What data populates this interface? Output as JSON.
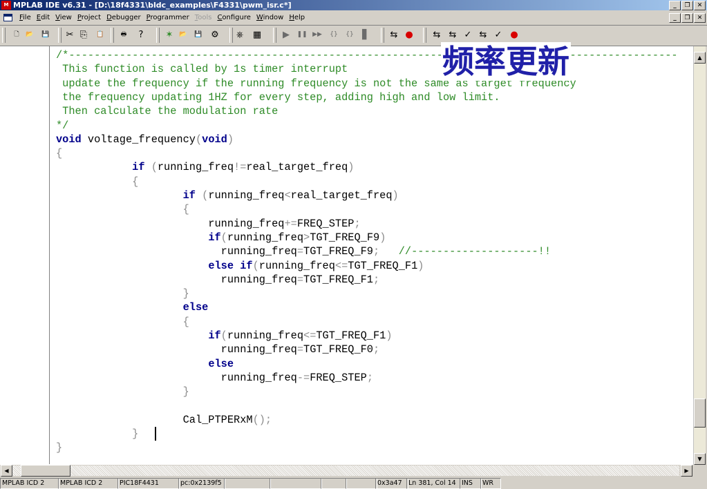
{
  "window": {
    "title": "MPLAB IDE v6.31 - [D:\\18f4331\\bldc_examples\\F4331\\pwm_isr.c*]",
    "app_icon_text": "M",
    "controls": {
      "minimize": "_",
      "restore": "❐",
      "close": "✕"
    }
  },
  "menu": {
    "items": [
      {
        "label": "File",
        "enabled": true
      },
      {
        "label": "Edit",
        "enabled": true
      },
      {
        "label": "View",
        "enabled": true
      },
      {
        "label": "Project",
        "enabled": true
      },
      {
        "label": "Debugger",
        "enabled": true
      },
      {
        "label": "Programmer",
        "enabled": true
      },
      {
        "label": "Tools",
        "enabled": false
      },
      {
        "label": "Configure",
        "enabled": true
      },
      {
        "label": "Window",
        "enabled": true
      },
      {
        "label": "Help",
        "enabled": true
      }
    ]
  },
  "toolbar": {
    "buttons": [
      {
        "name": "new-file-icon",
        "glyph": "🗋",
        "color": "#000000"
      },
      {
        "name": "open-file-icon",
        "glyph": "📂",
        "color": "#c09000"
      },
      {
        "name": "save-icon",
        "glyph": "💾",
        "color": "#000000"
      },
      {
        "name": "cut-icon",
        "glyph": "✂",
        "color": "#000000"
      },
      {
        "name": "copy-icon",
        "glyph": "⎘",
        "color": "#000000"
      },
      {
        "name": "paste-icon",
        "glyph": "📋",
        "color": "#000000"
      },
      {
        "name": "print-icon",
        "glyph": "🖶",
        "color": "#000000"
      },
      {
        "name": "help-icon",
        "glyph": "?",
        "color": "#000000"
      },
      {
        "name": "new-project-icon",
        "glyph": "✶",
        "color": "#2e8b27"
      },
      {
        "name": "open-project-icon",
        "glyph": "📂",
        "color": "#c09000"
      },
      {
        "name": "save-project-icon",
        "glyph": "💾",
        "color": "#000000"
      },
      {
        "name": "project-wizard-icon",
        "glyph": "⚙",
        "color": "#000000"
      },
      {
        "name": "build-icon",
        "glyph": "⎈",
        "color": "#000000"
      },
      {
        "name": "build-all-icon",
        "glyph": "▦",
        "color": "#000000"
      },
      {
        "name": "run-icon",
        "glyph": "▶",
        "color": "#6b6b6b"
      },
      {
        "name": "halt-icon",
        "glyph": "❚❚",
        "color": "#6b6b6b"
      },
      {
        "name": "animate-icon",
        "glyph": "▶▶",
        "color": "#6b6b6b"
      },
      {
        "name": "step-into-icon",
        "glyph": "{}",
        "color": "#6b6b6b"
      },
      {
        "name": "step-over-icon",
        "glyph": "{}",
        "color": "#6b6b6b"
      },
      {
        "name": "reset-icon",
        "glyph": "▋",
        "color": "#6b6b6b"
      },
      {
        "name": "debugger-connect-icon",
        "glyph": "⇆",
        "color": "#000000"
      },
      {
        "name": "debugger-settings-icon",
        "glyph": "●",
        "color": "#d80000"
      },
      {
        "name": "program-icon",
        "glyph": "⇆",
        "color": "#000000"
      },
      {
        "name": "read-icon",
        "glyph": "⇆",
        "color": "#000000"
      },
      {
        "name": "verify-icon",
        "glyph": "✓",
        "color": "#000000"
      },
      {
        "name": "erase-icon",
        "glyph": "⇆",
        "color": "#000000"
      },
      {
        "name": "blank-check-icon",
        "glyph": "✓",
        "color": "#000000"
      },
      {
        "name": "programmer-settings-icon",
        "glyph": "●",
        "color": "#d80000"
      }
    ]
  },
  "editor": {
    "overlay_text": "频率更新",
    "lines": [
      [
        {
          "t": "/*------------------------------------------------------------------------------------------------",
          "c": "cm"
        }
      ],
      [
        {
          "t": " This function is called by 1s timer interrupt",
          "c": "cm"
        }
      ],
      [
        {
          "t": " update the frequency if the running frequency is not the same as target frequency",
          "c": "cm"
        }
      ],
      [
        {
          "t": " the frequency updating 1HZ for every step, adding high and low limit.",
          "c": "cm"
        }
      ],
      [
        {
          "t": " Then calculate the modulation rate",
          "c": "cm"
        }
      ],
      [
        {
          "t": "*/",
          "c": "cm"
        }
      ],
      [
        {
          "t": "void",
          "c": "kw"
        },
        {
          "t": " voltage_frequency",
          "c": "pl"
        },
        {
          "t": "(",
          "c": "pu"
        },
        {
          "t": "void",
          "c": "kw"
        },
        {
          "t": ")",
          "c": "pu"
        }
      ],
      [
        {
          "t": "{",
          "c": "pu"
        }
      ],
      [
        {
          "t": "            ",
          "c": "pl"
        },
        {
          "t": "if",
          "c": "kw"
        },
        {
          "t": " (",
          "c": "pu"
        },
        {
          "t": "running_freq",
          "c": "pl"
        },
        {
          "t": "!=",
          "c": "pu"
        },
        {
          "t": "real_target_freq",
          "c": "pl"
        },
        {
          "t": ")",
          "c": "pu"
        }
      ],
      [
        {
          "t": "            {",
          "c": "pu"
        }
      ],
      [
        {
          "t": "                    ",
          "c": "pl"
        },
        {
          "t": "if",
          "c": "kw"
        },
        {
          "t": " (",
          "c": "pu"
        },
        {
          "t": "running_freq",
          "c": "pl"
        },
        {
          "t": "<",
          "c": "pu"
        },
        {
          "t": "real_target_freq",
          "c": "pl"
        },
        {
          "t": ")",
          "c": "pu"
        }
      ],
      [
        {
          "t": "                    {",
          "c": "pu"
        }
      ],
      [
        {
          "t": "                        running_freq",
          "c": "pl"
        },
        {
          "t": "+=",
          "c": "pu"
        },
        {
          "t": "FREQ_STEP",
          "c": "pl"
        },
        {
          "t": ";",
          "c": "pu"
        }
      ],
      [
        {
          "t": "                        ",
          "c": "pl"
        },
        {
          "t": "if",
          "c": "kw"
        },
        {
          "t": "(",
          "c": "pu"
        },
        {
          "t": "running_freq",
          "c": "pl"
        },
        {
          "t": ">",
          "c": "pu"
        },
        {
          "t": "TGT_FREQ_F9",
          "c": "pl"
        },
        {
          "t": ")",
          "c": "pu"
        }
      ],
      [
        {
          "t": "                          running_freq",
          "c": "pl"
        },
        {
          "t": "=",
          "c": "pu"
        },
        {
          "t": "TGT_FREQ_F9",
          "c": "pl"
        },
        {
          "t": ";",
          "c": "pu"
        },
        {
          "t": "   //--------------------!!",
          "c": "cm"
        }
      ],
      [
        {
          "t": "                        ",
          "c": "pl"
        },
        {
          "t": "else if",
          "c": "kw"
        },
        {
          "t": "(",
          "c": "pu"
        },
        {
          "t": "running_freq",
          "c": "pl"
        },
        {
          "t": "<=",
          "c": "pu"
        },
        {
          "t": "TGT_FREQ_F1",
          "c": "pl"
        },
        {
          "t": ")",
          "c": "pu"
        }
      ],
      [
        {
          "t": "                          running_freq",
          "c": "pl"
        },
        {
          "t": "=",
          "c": "pu"
        },
        {
          "t": "TGT_FREQ_F1",
          "c": "pl"
        },
        {
          "t": ";",
          "c": "pu"
        }
      ],
      [
        {
          "t": "                    }",
          "c": "pu"
        }
      ],
      [
        {
          "t": "                    ",
          "c": "pl"
        },
        {
          "t": "else",
          "c": "kw"
        }
      ],
      [
        {
          "t": "                    {",
          "c": "pu"
        }
      ],
      [
        {
          "t": "                        ",
          "c": "pl"
        },
        {
          "t": "if",
          "c": "kw"
        },
        {
          "t": "(",
          "c": "pu"
        },
        {
          "t": "running_freq",
          "c": "pl"
        },
        {
          "t": "<=",
          "c": "pu"
        },
        {
          "t": "TGT_FREQ_F1",
          "c": "pl"
        },
        {
          "t": ")",
          "c": "pu"
        }
      ],
      [
        {
          "t": "                          running_freq",
          "c": "pl"
        },
        {
          "t": "=",
          "c": "pu"
        },
        {
          "t": "TGT_FREQ_F0",
          "c": "pl"
        },
        {
          "t": ";",
          "c": "pu"
        }
      ],
      [
        {
          "t": "                        ",
          "c": "pl"
        },
        {
          "t": "else",
          "c": "kw"
        }
      ],
      [
        {
          "t": "                          running_freq",
          "c": "pl"
        },
        {
          "t": "-=",
          "c": "pu"
        },
        {
          "t": "FREQ_STEP",
          "c": "pl"
        },
        {
          "t": ";",
          "c": "pu"
        }
      ],
      [
        {
          "t": "                    }",
          "c": "pu"
        }
      ],
      [
        {
          "t": "",
          "c": "pl"
        }
      ],
      [
        {
          "t": "                    Cal_PTPERxM",
          "c": "pl"
        },
        {
          "t": "();",
          "c": "pu"
        }
      ],
      [
        {
          "t": "            }",
          "c": "pu"
        }
      ],
      [
        {
          "t": "}",
          "c": "pu"
        }
      ]
    ]
  },
  "scrollbar": {
    "up": "▲",
    "down": "▼",
    "left": "◀",
    "right": "▶"
  },
  "status": {
    "panes": [
      "MPLAB ICD 2",
      "MPLAB ICD 2",
      "PIC18F4431",
      "pc:0x2139f5",
      "",
      "",
      "",
      "",
      "0x3a47",
      "Ln 381, Col 14",
      "INS",
      "WR"
    ]
  },
  "colors": {
    "comment": "#2e8b27",
    "keyword": "#00008b",
    "punct": "#8c8c8c",
    "overlay": "#2020a8",
    "titlebar": "#0a246a"
  }
}
